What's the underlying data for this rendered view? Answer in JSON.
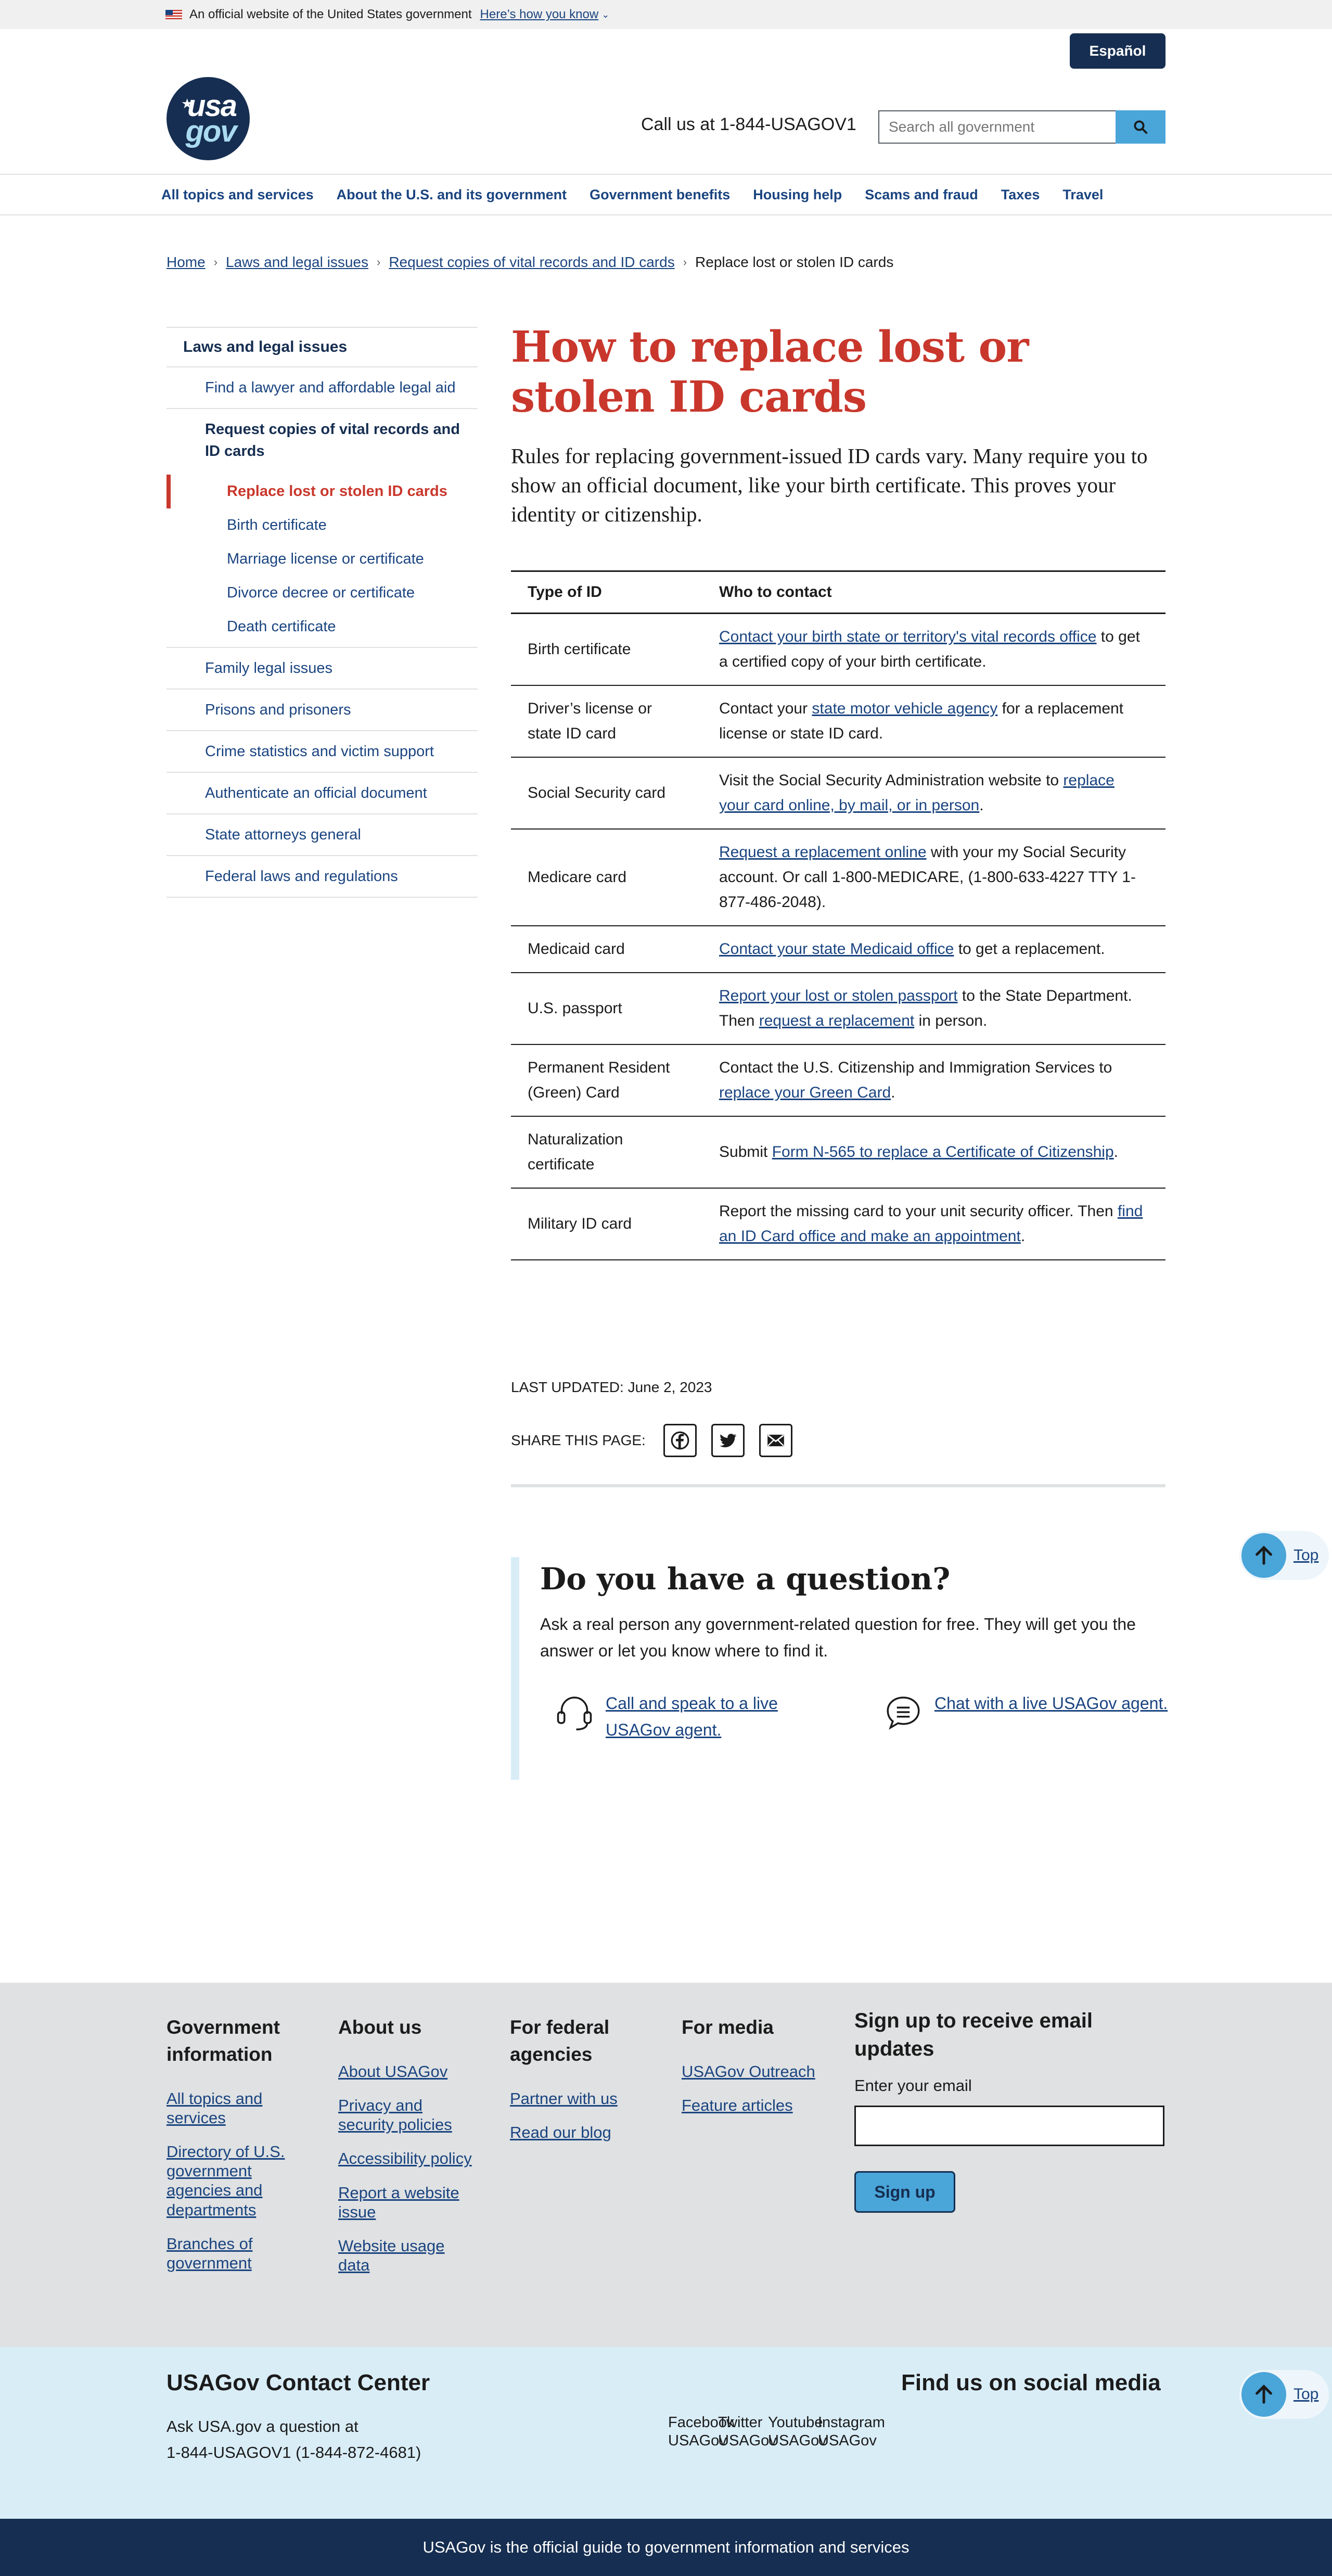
{
  "banner": {
    "text": "An official website of the United States government",
    "link": "Here’s how you know"
  },
  "header": {
    "espanol": "Español",
    "logo_line1": "usa",
    "logo_line2": "gov",
    "callus": "Call us at 1-844-USAGOV1",
    "search_placeholder": "Search all government"
  },
  "nav": [
    "All topics and services",
    "About the U.S. and its government",
    "Government benefits",
    "Housing help",
    "Scams and fraud",
    "Taxes",
    "Travel"
  ],
  "breadcrumb": [
    "Home",
    "Laws and legal issues",
    "Request copies of vital records and ID cards",
    "Replace lost or stolen ID cards"
  ],
  "sidebar": {
    "top": "Laws and legal issues",
    "items": [
      "Find a lawyer and affordable legal aid",
      "Request copies of vital records and ID cards"
    ],
    "sub": [
      "Replace lost or stolen ID cards",
      "Birth certificate",
      "Marriage license or certificate",
      "Divorce decree or certificate",
      "Death certificate"
    ],
    "more": [
      "Family legal issues",
      "Prisons and prisoners",
      "Crime statistics and victim support",
      "Authenticate an official document",
      "State attorneys general",
      "Federal laws and regulations"
    ]
  },
  "main": {
    "title": "How to replace lost or stolen ID cards",
    "intro": "Rules for replacing government-issued ID cards vary. Many require you to show an official document, like your birth certificate. This proves your identity or citizenship."
  },
  "table": {
    "headers": [
      "Type of ID",
      "Who to contact"
    ],
    "rows": [
      {
        "type": "Birth certificate",
        "pre": "",
        "link": "Contact your birth state or territory's vital records office",
        "post": " to get a certified copy of your birth certificate."
      },
      {
        "type": "Driver’s license or state ID card",
        "pre": "Contact your ",
        "link": "state motor vehicle agency",
        "post": " for a replacement license or state ID card."
      },
      {
        "type": "Social Security card",
        "pre": "Visit the Social Security Administration website to ",
        "link": "replace your card online, by mail, or in person",
        "post": "."
      },
      {
        "type": "Medicare card",
        "pre": "",
        "link": "Request a replacement online",
        "post": " with your my Social Security account. Or call 1-800-MEDICARE, (1-800-633-4227 TTY 1-877-486-2048)."
      },
      {
        "type": "Medicaid card",
        "pre": "",
        "link": "Contact your state Medicaid office",
        "post": " to get a replacement."
      },
      {
        "type": "U.S. passport",
        "pre": "",
        "link": "Report your lost or stolen passport",
        "post": " to the State Department. Then ",
        "link2": "request a replacement",
        "post2": " in person."
      },
      {
        "type": "Permanent Resident (Green) Card",
        "pre": "Contact the U.S. Citizenship and Immigration Services to ",
        "link": "replace your Green Card",
        "post": "."
      },
      {
        "type": "Naturalization certificate",
        "pre": "Submit ",
        "link": "Form N-565 to replace a Certificate of Citizenship",
        "post": "."
      },
      {
        "type": "Military ID card",
        "pre": "Report the missing card to your unit security officer. Then ",
        "link": "find an ID Card office and make an appointment",
        "post": "."
      }
    ]
  },
  "updated": "LAST UPDATED: June 2, 2023",
  "share_label": "SHARE THIS PAGE:",
  "question": {
    "title": "Do you have a question?",
    "text": "Ask a real person any government-related question for free. They will get you the answer or let you know where to find it.",
    "call": "Call and speak to a live USAGov agent.",
    "chat": "Chat with a live USAGov agent."
  },
  "top_label": "Top",
  "footer": {
    "col1": {
      "title": "Government information",
      "links": [
        "All topics and services",
        "Directory of U.S. government agencies and departments",
        "Branches of government"
      ]
    },
    "col2": {
      "title": "About us",
      "links": [
        "About USAGov",
        "Privacy and security policies",
        "Accessibility policy",
        "Report a website issue",
        "Website usage data"
      ]
    },
    "col3": {
      "title": "For federal agencies",
      "links": [
        "Partner with us",
        "Read our blog"
      ]
    },
    "col4": {
      "title": "For media",
      "links": [
        "USAGov Outreach",
        "Feature articles"
      ]
    },
    "signup": {
      "title": "Sign up to receive email updates",
      "label": "Enter your email",
      "button": "Sign up"
    }
  },
  "contact": {
    "title": "USAGov Contact Center",
    "ask1": "Ask USA.gov a question at",
    "ask2": "1-844-USAGOV1 (1-844-872-4681)",
    "social_title": "Find us on social media",
    "social": [
      [
        "Facebook",
        "USAGov"
      ],
      [
        "Twitter",
        "USAGov"
      ],
      [
        "Youtube",
        "USAGov"
      ],
      [
        "Instagram",
        "USAGov"
      ]
    ]
  },
  "bottom": "USAGov is the official guide to government information and services",
  "colors": {
    "navy": "#162e51",
    "link": "#1a4480",
    "red": "#c9372c",
    "cyan": "#4aa5d9",
    "light_blue": "#d9edf7",
    "gray": "#dfe1e2"
  }
}
